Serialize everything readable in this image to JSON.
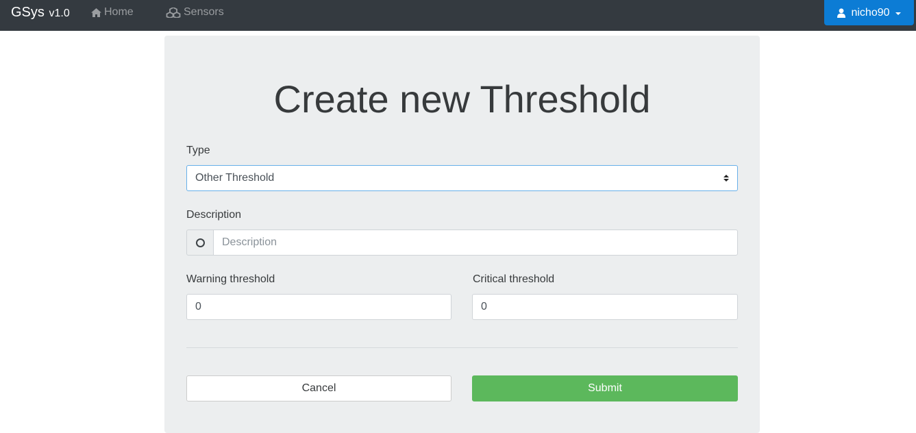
{
  "navbar": {
    "brand": "GSys",
    "version": "v1.0",
    "links": [
      {
        "label": "Home",
        "icon": "home-icon"
      },
      {
        "label": "Sensors",
        "icon": "cubes-icon"
      }
    ],
    "user": {
      "name": "nicho90",
      "icon": "user-icon",
      "color": "#0c7cd5"
    }
  },
  "form": {
    "title": "Create new Threshold",
    "type_label": "Type",
    "type_value": "Other Threshold",
    "description_label": "Description",
    "description_placeholder": "Description",
    "description_icon": "circle-icon",
    "warning_label": "Warning threshold",
    "warning_value": "0",
    "critical_label": "Critical threshold",
    "critical_value": "0",
    "cancel_label": "Cancel",
    "submit_label": "Submit",
    "submit_color": "#5cb85c"
  }
}
